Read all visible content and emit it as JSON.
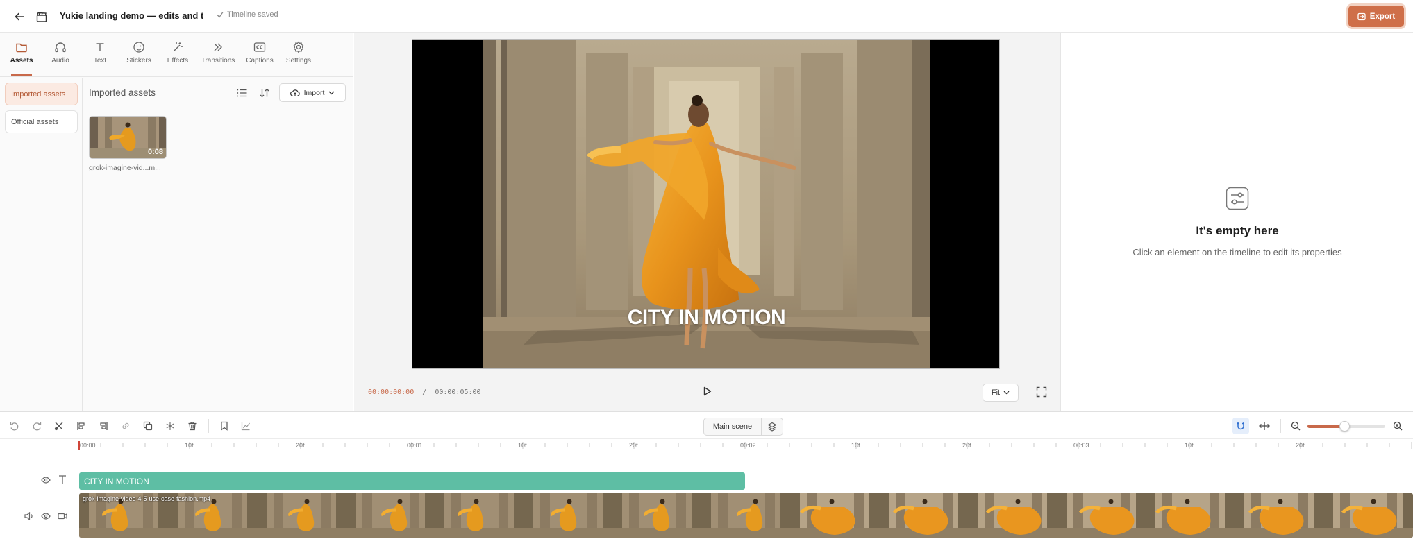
{
  "header": {
    "title": "Yukie landing demo — edits and transitions",
    "saved_status": "Timeline saved",
    "export_label": "Export"
  },
  "left_panel": {
    "tabs": [
      {
        "label": "Assets",
        "icon": "folder-icon"
      },
      {
        "label": "Audio",
        "icon": "headphones-icon"
      },
      {
        "label": "Text",
        "icon": "text-icon"
      },
      {
        "label": "Stickers",
        "icon": "smile-icon"
      },
      {
        "label": "Effects",
        "icon": "magic-wand-icon"
      },
      {
        "label": "Transitions",
        "icon": "double-chevron-icon"
      },
      {
        "label": "Captions",
        "icon": "cc-icon"
      },
      {
        "label": "Settings",
        "icon": "gear-icon"
      }
    ],
    "active_tab": "Assets",
    "categories": [
      "Imported assets",
      "Official assets"
    ],
    "active_category": "Imported assets",
    "assets_title": "Imported assets",
    "import_label": "Import",
    "assets": [
      {
        "name": "grok-imagine-vid...m...",
        "duration": "0:08"
      }
    ]
  },
  "preview": {
    "caption": "CITY IN MOTION",
    "current_time": "00:00:00:00",
    "separator": "/",
    "total_time": "00:00:05:00",
    "fit_label": "Fit"
  },
  "properties": {
    "empty_title": "It's empty here",
    "empty_subtitle": "Click an element on the timeline to edit its properties"
  },
  "timeline": {
    "scene_label": "Main scene",
    "ruler_labels": [
      "00:00",
      "10f",
      "20f",
      "00:01",
      "10f",
      "20f",
      "00:02",
      "10f",
      "20f",
      "00:03",
      "10f",
      "20f"
    ],
    "text_clip": "CITY IN MOTION",
    "video_clip": "grok-imagine-video-4-5-use-case-fashion.mp4",
    "zoom_level": 0.47
  },
  "colors": {
    "accent": "#c8694a",
    "export_bg": "#cf6f49",
    "text_clip": "#5ebea4",
    "playhead": "#d0453a"
  }
}
